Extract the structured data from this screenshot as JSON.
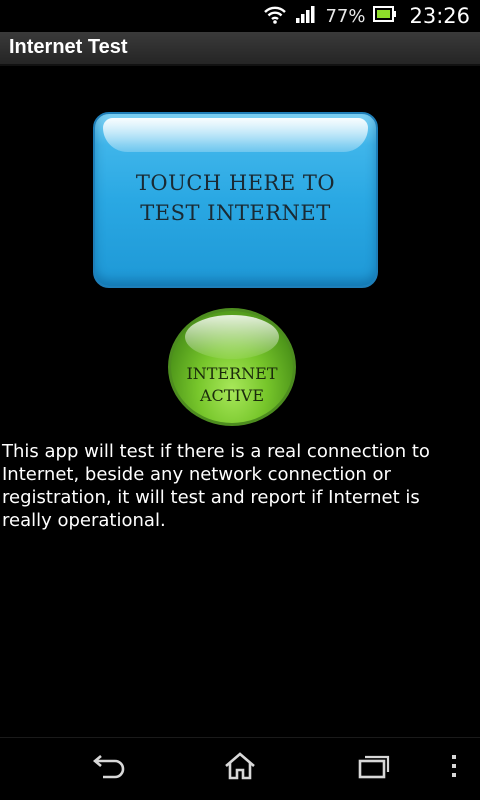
{
  "status_bar": {
    "battery_percent": "77%",
    "time": "23:26"
  },
  "app_bar": {
    "title": "Internet Test"
  },
  "test_button": {
    "line1": "TOUCH HERE TO",
    "line2": "TEST INTERNET",
    "color": "#2aa8e3"
  },
  "status_indicator": {
    "line1": "INTERNET",
    "line2": "ACTIVE",
    "color": "#77c62b"
  },
  "description": "This app will test if there is a real connection to Internet, beside any network connection or registration, it will test and report if Internet is really operational.",
  "nav_bar": {
    "icons": [
      "back-icon",
      "home-icon",
      "recent-apps-icon",
      "overflow-menu-icon"
    ]
  }
}
